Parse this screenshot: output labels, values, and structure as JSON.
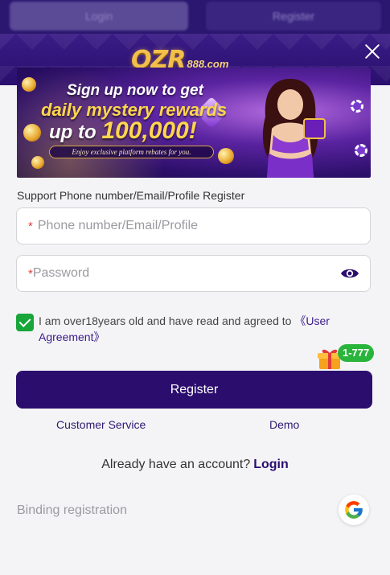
{
  "background": {
    "button_left_label": "Login",
    "button_right_label": "Register"
  },
  "header": {
    "logo_text": "QZR",
    "logo_suffix": "888.com"
  },
  "banner": {
    "line1": "Sign up now to get",
    "line2": "daily mystery rewards",
    "line3_prefix": "up to ",
    "line3_amount": "100,000!",
    "line4": "Enjoy exclusive platform rebates for you."
  },
  "form": {
    "support_label": "Support Phone number/Email/Profile Register",
    "account_placeholder": "Phone number/Email/Profile",
    "account_required_mark": "*",
    "password_placeholder": "Password",
    "password_required_mark": "*",
    "agree_checked": true,
    "agree_text": "I am over18years old and have read and agreed to ",
    "agree_link": "《User Agreement》",
    "gift_badge": "1-777",
    "register_label": "Register"
  },
  "links": {
    "customer_service": "Customer Service",
    "demo": "Demo",
    "already_text": "Already have an account?",
    "login_label": "Login",
    "binding_label": "Binding registration"
  },
  "colors": {
    "primary": "#2b0d6e",
    "header_bg": "#2a0f6e",
    "checkbox": "#18a63a",
    "required": "#e0433a",
    "badge": "#29b43b"
  }
}
